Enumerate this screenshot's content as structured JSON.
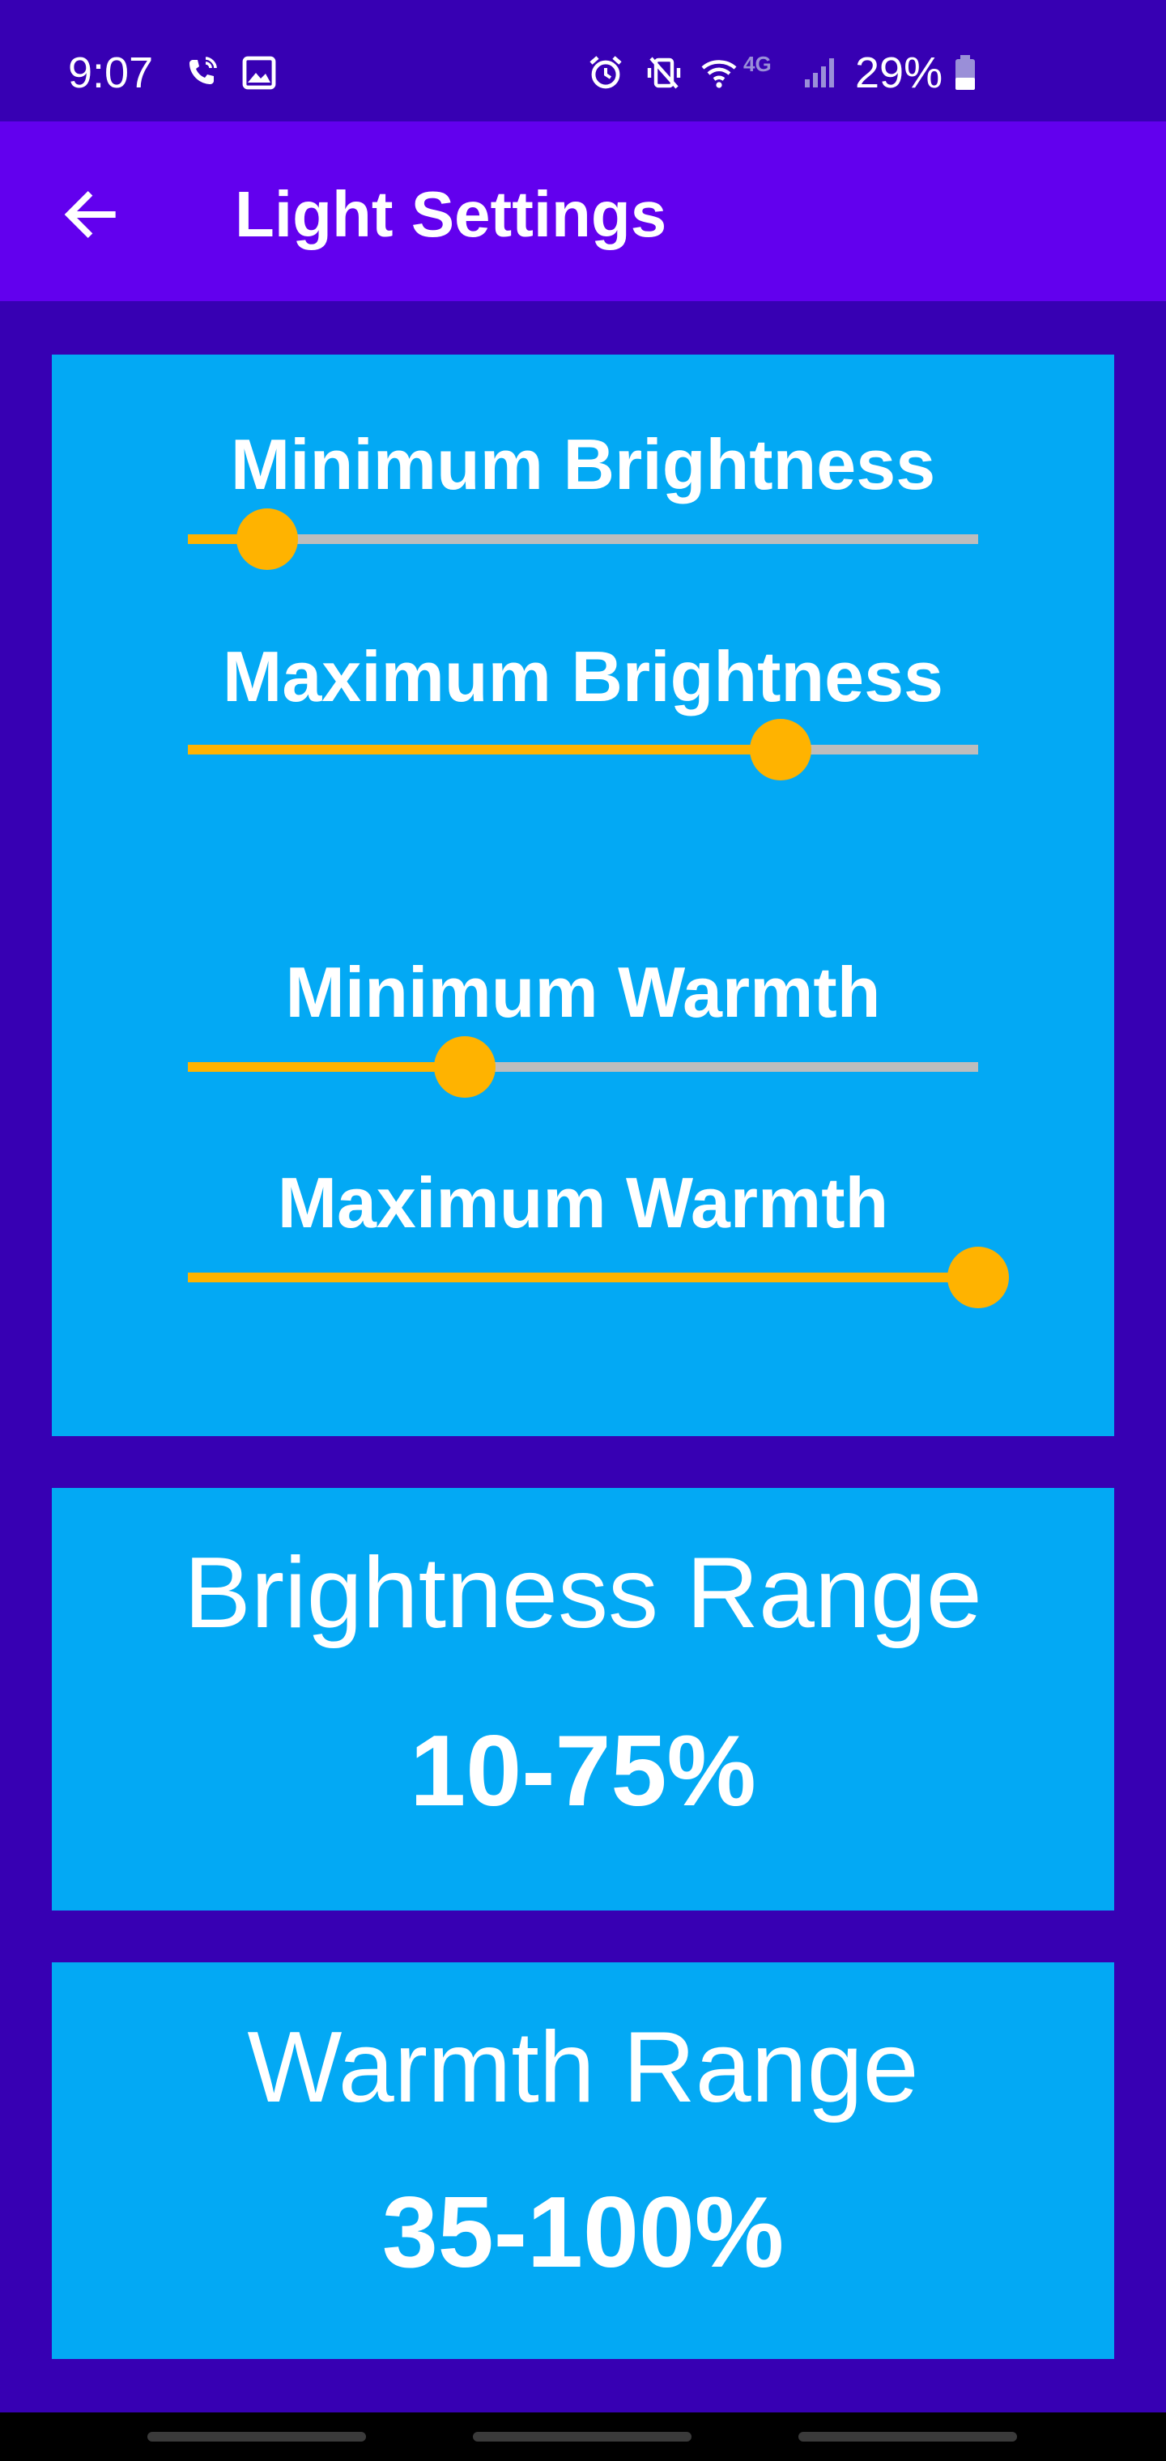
{
  "status_bar": {
    "time": "9:07",
    "battery": "29%",
    "network": "4G",
    "icons": [
      "wifi-calling-icon",
      "image-icon",
      "alarm-icon",
      "vibrate-icon",
      "wifi-icon",
      "signal-icon",
      "battery-icon"
    ]
  },
  "app_bar": {
    "title": "Light Settings",
    "back_icon": "arrow-left-icon"
  },
  "sliders": {
    "min_brightness": {
      "label": "Minimum Brightness",
      "value": 10
    },
    "max_brightness": {
      "label": "Maximum Brightness",
      "value": 75
    },
    "min_warmth": {
      "label": "Minimum Warmth",
      "value": 35
    },
    "max_warmth": {
      "label": "Maximum Warmth",
      "value": 100
    }
  },
  "summary": {
    "brightness": {
      "title": "Brightness Range",
      "value": "10-75%"
    },
    "warmth": {
      "title": "Warmth Range",
      "value": "35-100%"
    }
  },
  "colors": {
    "background": "#3700b3",
    "app_bar": "#6200ee",
    "card": "#03a9f4",
    "accent": "#ffb300",
    "track": "#bdbdbd"
  }
}
